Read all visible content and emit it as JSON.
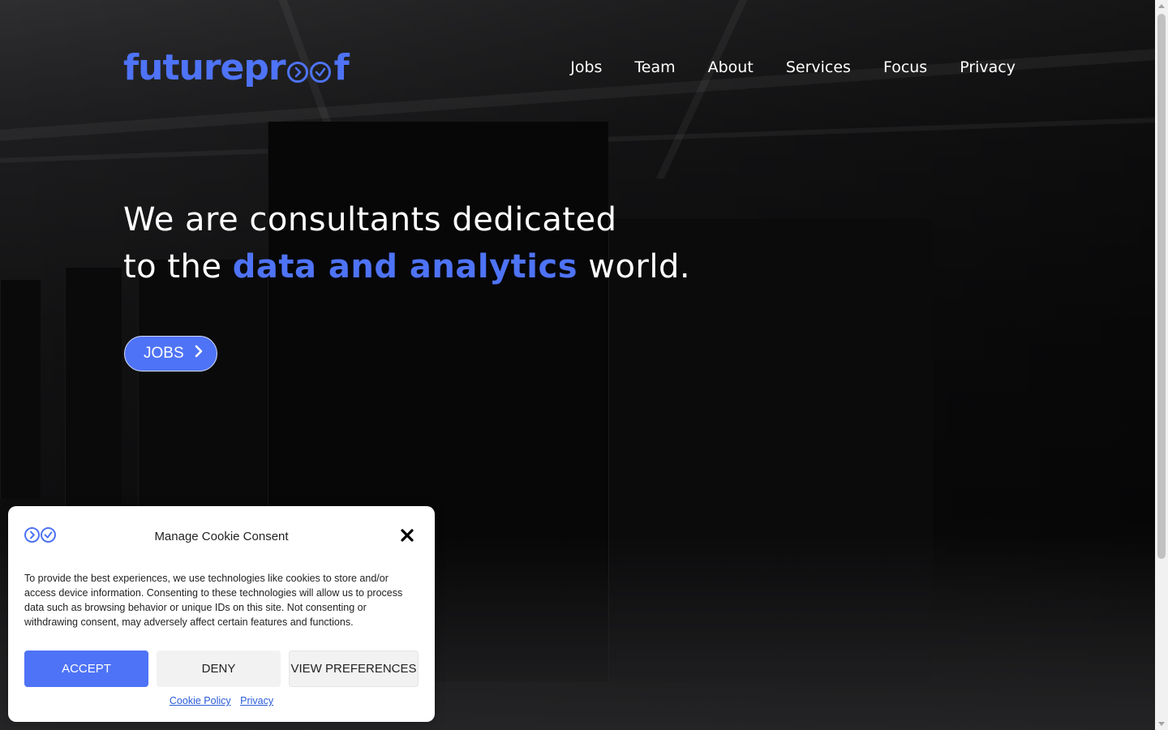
{
  "brand": {
    "logo_prefix": "futurepr",
    "logo_suffix": "f",
    "accent_color": "#4e73f6"
  },
  "nav": {
    "items": [
      "Jobs",
      "Team",
      "About",
      "Services",
      "Focus",
      "Privacy"
    ]
  },
  "hero": {
    "line1": "We are consultants dedicated",
    "line2_pre": "to the ",
    "line2_accent": "data and analytics",
    "line2_post": " world.",
    "cta_label": "JOBS",
    "cta_icon": "chevron-right-icon"
  },
  "cookie": {
    "title": "Manage Cookie Consent",
    "body": "To provide the best experiences, we use technologies like cookies to store and/or access device information. Consenting to these technologies will allow us to process data such as browsing behavior or unique IDs on this site. Not consenting or withdrawing consent, may adversely affect certain features and functions.",
    "accept_label": "ACCEPT",
    "deny_label": "DENY",
    "prefs_label": "VIEW PREFERENCES",
    "link_cookie_policy": "Cookie Policy",
    "link_privacy": "Privacy",
    "close_icon": "close-icon"
  }
}
